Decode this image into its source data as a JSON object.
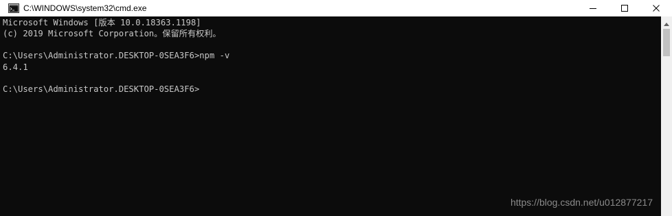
{
  "window": {
    "title": "C:\\WINDOWS\\system32\\cmd.exe",
    "icons": {
      "app": "cmd-icon",
      "minimize": "minimize-icon",
      "maximize": "maximize-icon",
      "close": "close-icon"
    }
  },
  "console": {
    "lines": [
      "Microsoft Windows [版本 10.0.18363.1198]",
      "(c) 2019 Microsoft Corporation。保留所有权利。",
      "",
      "C:\\Users\\Administrator.DESKTOP-0SEA3F6>npm -v",
      "6.4.1",
      "",
      "C:\\Users\\Administrator.DESKTOP-0SEA3F6>"
    ]
  },
  "watermark": "https://blog.csdn.net/u012877217",
  "colors": {
    "console_bg": "#0c0c0c",
    "console_text": "#c8c8c8",
    "titlebar_bg": "#ffffff",
    "watermark_text": "#8a8a8a"
  }
}
